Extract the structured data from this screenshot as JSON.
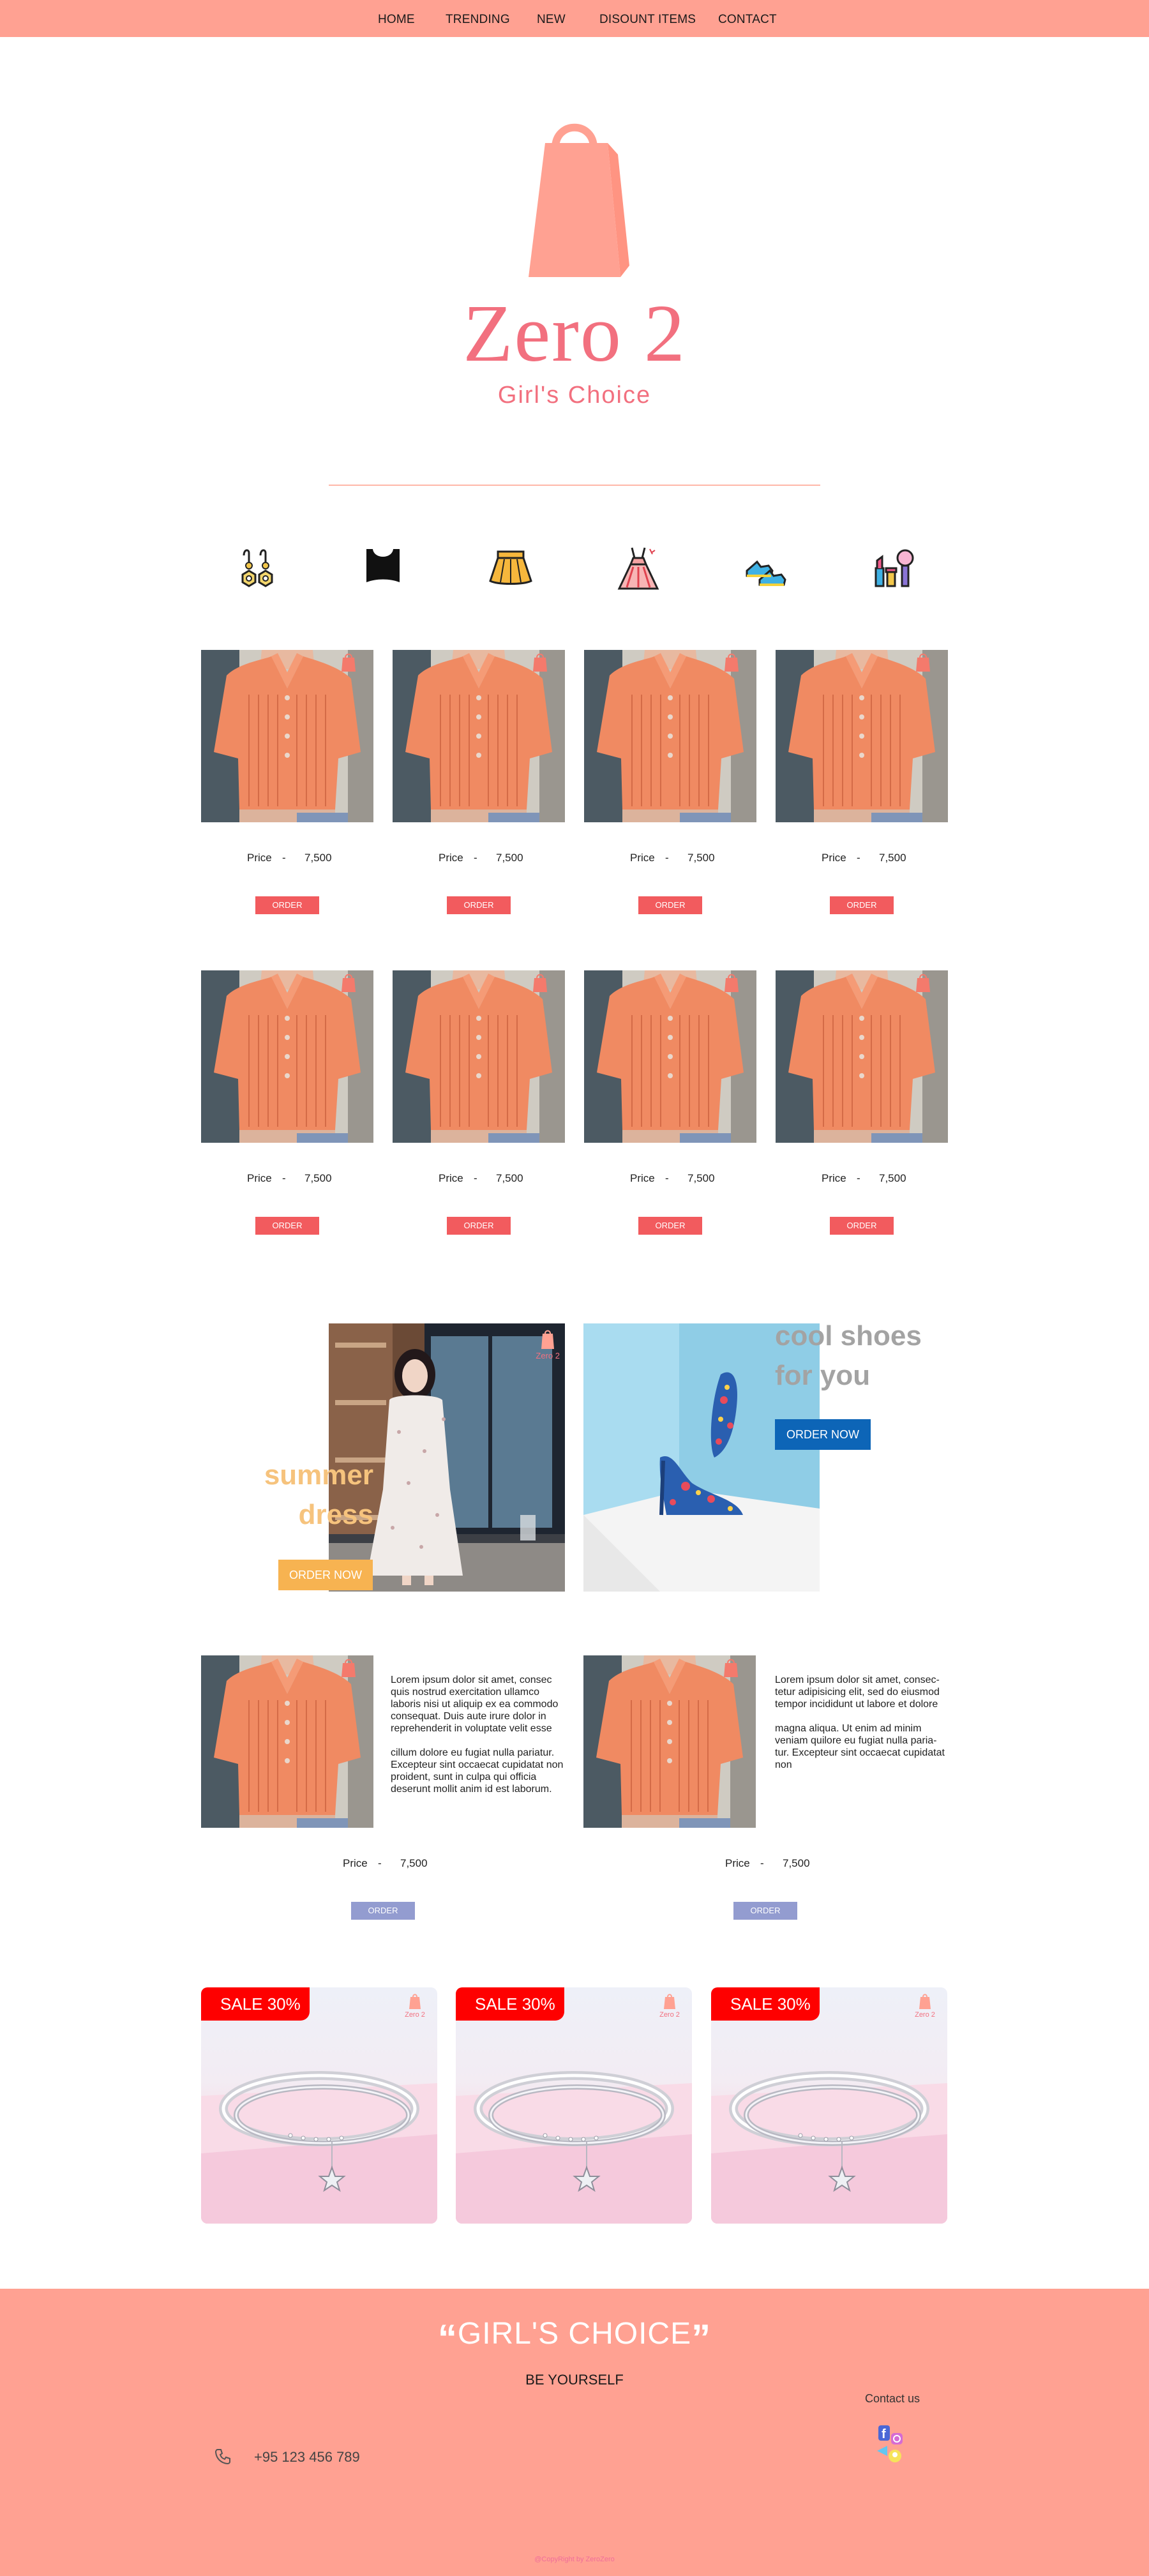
{
  "nav": {
    "items": [
      "HOME",
      "TRENDING",
      "NEW",
      "DISOUNT ITEMS",
      "CONTACT"
    ]
  },
  "brand": {
    "title": "Zero 2",
    "subtitle": "Girl's Choice",
    "mini_logo_text": "Zero 2"
  },
  "categories": [
    "earrings-icon",
    "crop-top-icon",
    "skirt-icon",
    "dress-icon",
    "shoes-icon",
    "makeup-icon"
  ],
  "products": {
    "price_label": "Price",
    "dash": "-",
    "price_value": "7,500",
    "order_label": "ORDER",
    "rows": 2,
    "per_row": 4
  },
  "promo": {
    "dress_title_line1": "summer",
    "dress_title_line2": "dress",
    "dress_button": "ORDER NOW",
    "shoes_title_line1": "cool shoes",
    "shoes_title_line2": "for you",
    "shoes_button": "ORDER NOW"
  },
  "featured": {
    "left_desc": [
      "Lorem ipsum dolor sit amet, consec quis nostrud exercitation ullamco laboris nisi ut aliquip ex ea commodo consequat. Duis aute irure dolor in reprehenderit in voluptate velit esse",
      "cillum dolore eu fugiat nulla pariatur. Excepteur sint occaecat cupidatat non proident, sunt in culpa qui officia deserunt mollit anim id est laborum."
    ],
    "right_desc": [
      "Lorem ipsum dolor sit amet, consec-tetur adipisicing elit, sed do eiusmod tempor incididunt ut labore et dolore",
      "magna aliqua. Ut enim ad minim veniam quilore eu fugiat nulla paria-tur. Excepteur sint occaecat cupidatat non"
    ],
    "price_label": "Price",
    "dash": "-",
    "price_value": "7,500",
    "order_label": "ORDER"
  },
  "sale": {
    "badge": "SALE 30%",
    "count": 3
  },
  "footer": {
    "quote": "GIRL'S CHOICE",
    "tagline": "BE YOURSELF",
    "contact_label": "Contact us",
    "phone": "+95 123 456 789",
    "copyright": "@CopyRight by ZeroZero"
  },
  "colors": {
    "nav_bg": "#ffa192",
    "brand_pink": "#f2707f",
    "order_red": "#f25b5e",
    "order_blue": "#939cd0",
    "sale_red": "#fe0000",
    "dress_orange": "#f7b351",
    "shoes_blue": "#0d65b7"
  }
}
